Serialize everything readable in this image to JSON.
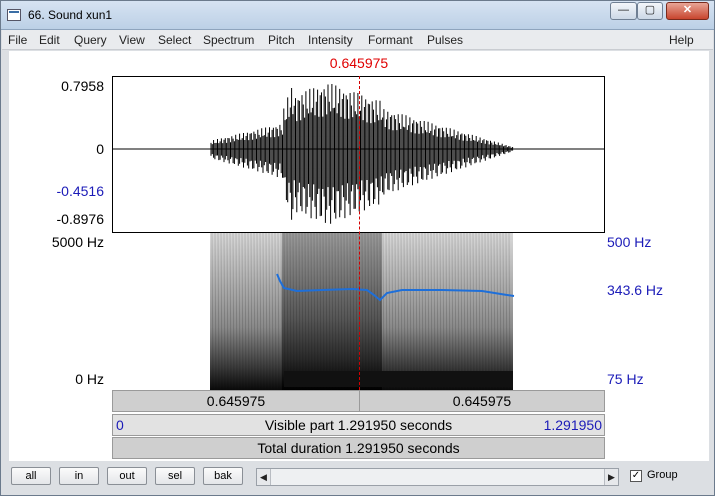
{
  "window": {
    "title": "66. Sound xun1",
    "min_label": "—",
    "max_label": "▢",
    "close_label": "✕"
  },
  "menu": [
    "File",
    "Edit",
    "Query",
    "View",
    "Select",
    "Spectrum",
    "Pitch",
    "Intensity",
    "Formant",
    "Pulses",
    "Help"
  ],
  "cursor_time": "0.645975",
  "waveform": {
    "y_max": "0.7958",
    "y_zero": "0",
    "y_neg1": "-0.4516",
    "y_min": "-0.8976"
  },
  "spectrogram": {
    "freq_top": "5000 Hz",
    "freq_bottom": "0 Hz",
    "pitch_top": "500 Hz",
    "pitch_mid": "343.6 Hz",
    "pitch_bottom": "75 Hz"
  },
  "bars": {
    "left_time": "0.645975",
    "right_time": "0.645975",
    "visible_start": "0",
    "visible_text": "Visible part 1.291950 seconds",
    "visible_end": "1.291950",
    "total_text": "Total duration 1.291950 seconds"
  },
  "toolbar": {
    "buttons": [
      "all",
      "in",
      "out",
      "sel",
      "bak"
    ],
    "group_label": "Group",
    "group_checked": true
  },
  "colors": {
    "cursor": "#e00000",
    "pitch_curve": "#1e6fd9",
    "axis_blue": "#1b1bb8"
  }
}
